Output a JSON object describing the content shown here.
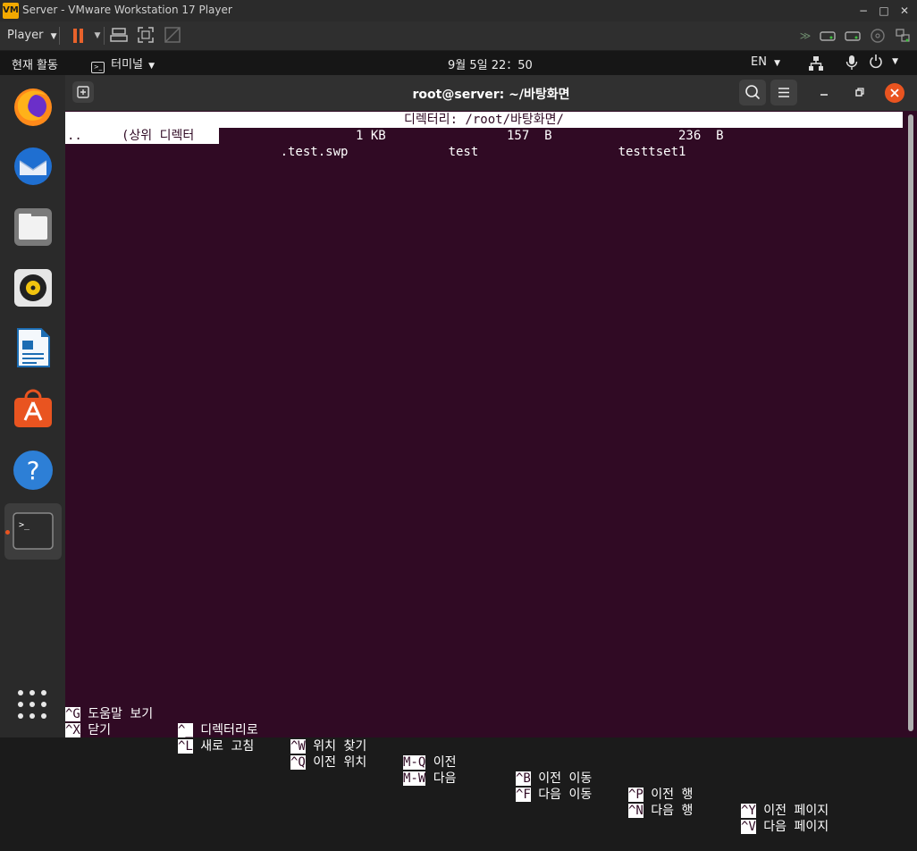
{
  "vm": {
    "title": "Server - VMware Workstation 17 Player",
    "logo_text": "VM",
    "player_label": "Player",
    "icons": [
      "pause-icon",
      "dropdown-icon",
      "send-keys-icon",
      "fullscreen-icon",
      "unity-icon",
      "forward-icon",
      "hdd-icon",
      "hdd-icon",
      "cd-icon",
      "network-icon"
    ],
    "controls": {
      "minimize": "−",
      "maximize": "□",
      "close": "✕"
    }
  },
  "gnome": {
    "activities": "현재 활동",
    "app_menu": "터미널",
    "clock": "9월 5일  22：50",
    "lang": "EN"
  },
  "terminal": {
    "title": "root@server: ~/바탕화면",
    "header_path": "디렉터리: /root/바탕화면/",
    "row": {
      "parent_name": "..",
      "parent_label": "(상위 디렉터",
      "files": [
        {
          "name": ".test.swp",
          "size": "1 KB"
        },
        {
          "name": "test",
          "size": "157  B"
        },
        {
          "name": "testtset1",
          "size": "236  B"
        }
      ]
    },
    "shortcuts_row1": [
      {
        "key": "^G",
        "label": "도움말 보기"
      },
      {
        "key": "^_",
        "label": "디렉터리로"
      },
      {
        "key": "^W",
        "label": "위치 찾기"
      },
      {
        "key": "M-Q",
        "label": "이전"
      },
      {
        "key": "^B",
        "label": "이전 이동"
      },
      {
        "key": "^P",
        "label": "이전 행"
      },
      {
        "key": "^Y",
        "label": "이전 페이지"
      }
    ],
    "shortcuts_row2": [
      {
        "key": "^X",
        "label": "닫기"
      },
      {
        "key": "^L",
        "label": "새로 고침"
      },
      {
        "key": "^Q",
        "label": "이전 위치"
      },
      {
        "key": "M-W",
        "label": "다음"
      },
      {
        "key": "^F",
        "label": "다음 이동"
      },
      {
        "key": "^N",
        "label": "다음 행"
      },
      {
        "key": "^V",
        "label": "다음 페이지"
      }
    ]
  },
  "dock": {
    "items": [
      "firefox-icon",
      "thunderbird-icon",
      "files-icon",
      "rhythmbox-icon",
      "writer-icon",
      "app-center-icon",
      "help-icon",
      "terminal-icon"
    ]
  },
  "colors": {
    "terminal_bg": "#300a24",
    "accent": "#e95420",
    "vm_pause": "#e8622b"
  }
}
